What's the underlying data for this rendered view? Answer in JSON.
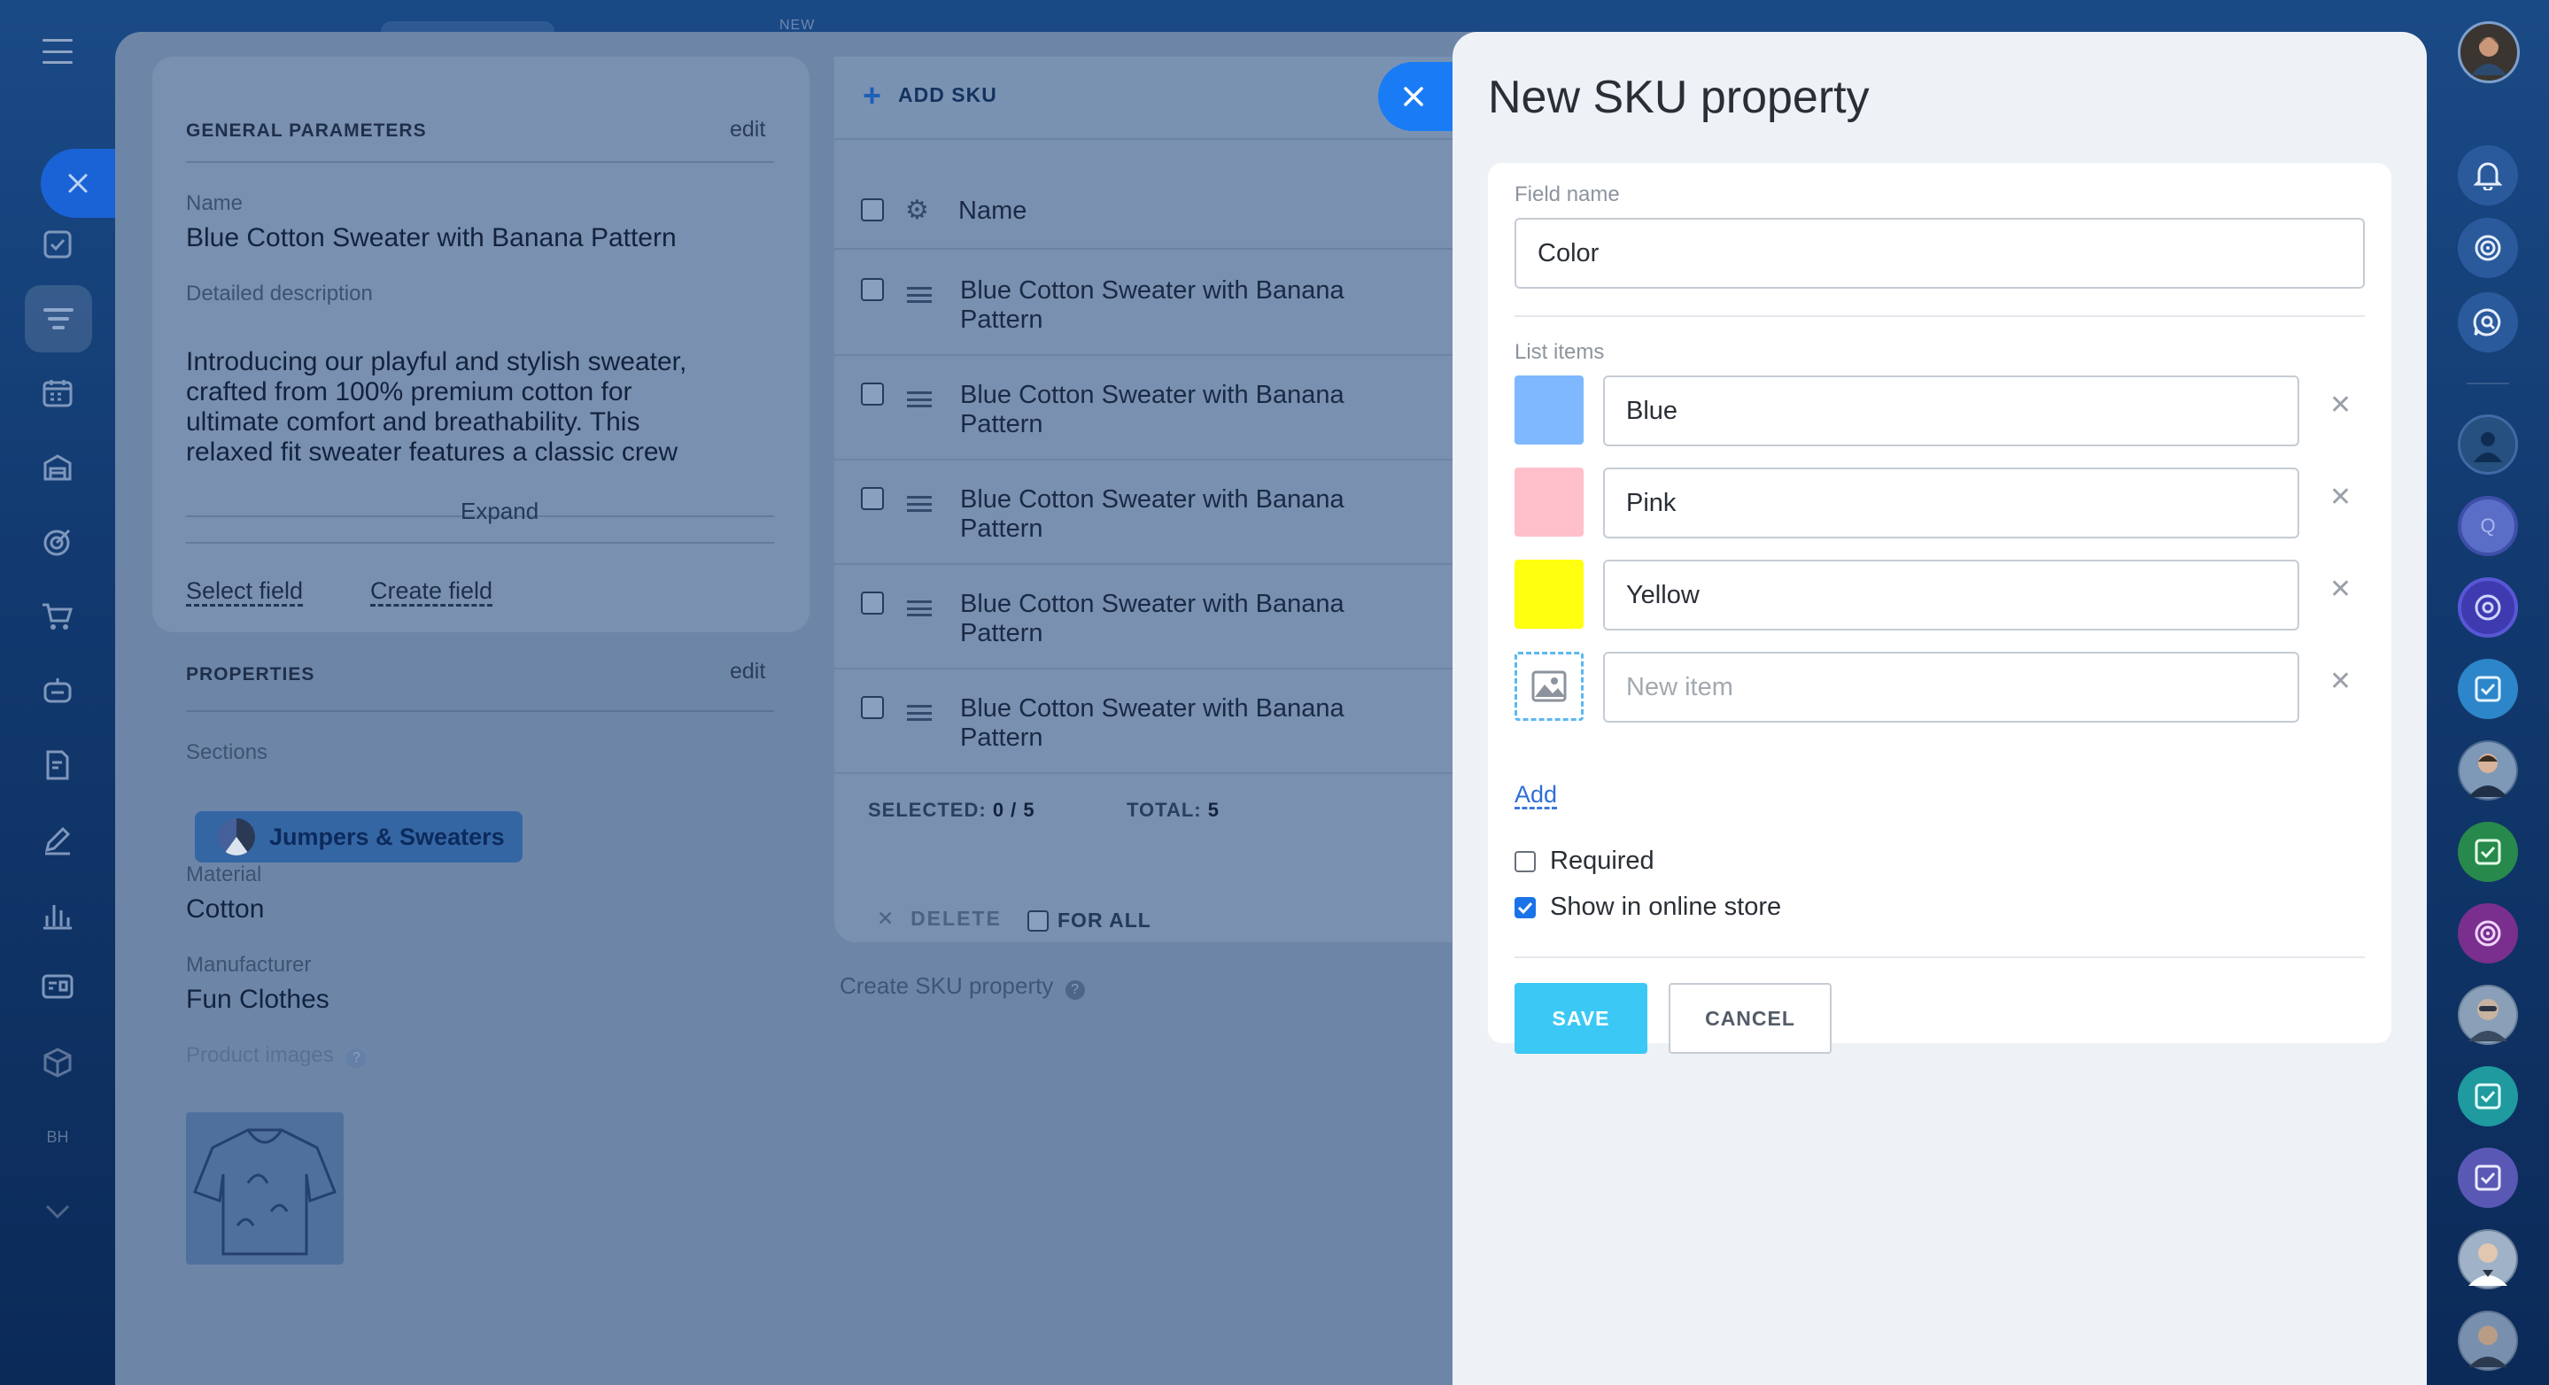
{
  "left_nav": {
    "items": [
      "tasks",
      "catalog",
      "calendar",
      "warehouse",
      "target",
      "cart",
      "robot",
      "edit-doc",
      "sign",
      "analytics",
      "card",
      "box",
      "bh",
      "more"
    ],
    "bh_label": "BH"
  },
  "top": {
    "new_badge": "NEW"
  },
  "general": {
    "title": "GENERAL PARAMETERS",
    "edit": "edit",
    "name_label": "Name",
    "name_value": "Blue Cotton Sweater with Banana Pattern",
    "desc_label": "Detailed description",
    "desc_value": "Introducing our playful and stylish sweater, crafted from 100% premium cotton for ultimate comfort and breathability. This relaxed fit sweater features a classic crew",
    "expand": "Expand",
    "select_field": "Select field",
    "create_field": "Create field"
  },
  "properties": {
    "title": "PROPERTIES",
    "edit": "edit",
    "sections_label": "Sections",
    "section_chip": "Jumpers & Sweaters",
    "material_label": "Material",
    "material_value": "Cotton",
    "manufacturer_label": "Manufacturer",
    "manufacturer_value": "Fun Clothes",
    "images_label": "Product images"
  },
  "sku": {
    "add_label": "ADD SKU",
    "col_name": "Name",
    "rows": [
      "Blue Cotton Sweater with Banana Pattern",
      "Blue Cotton Sweater with Banana Pattern",
      "Blue Cotton Sweater with Banana Pattern",
      "Blue Cotton Sweater with Banana Pattern",
      "Blue Cotton Sweater with Banana Pattern"
    ],
    "selected_label": "SELECTED:",
    "selected_value": "0 / 5",
    "total_label": "TOTAL:",
    "total_value": "5",
    "delete": "DELETE",
    "for_all": "FOR ALL",
    "create_property": "Create SKU property"
  },
  "panel": {
    "title": "New SKU property",
    "field_name_label": "Field name",
    "field_name_value": "Color",
    "list_items_label": "List items",
    "items": [
      {
        "value": "Blue",
        "color": "#7fb8ff"
      },
      {
        "value": "Pink",
        "color": "#ffc0cb"
      },
      {
        "value": "Yellow",
        "color": "#ffff10"
      }
    ],
    "new_item_placeholder": "New item",
    "add": "Add",
    "required_label": "Required",
    "required_checked": false,
    "show_online_label": "Show in online store",
    "show_online_checked": true,
    "save": "SAVE",
    "cancel": "CANCEL"
  },
  "right_bar": {
    "items": [
      "user-avatar",
      "bell-icon",
      "target-icon",
      "chat-search-icon",
      "avatar-1",
      "q-avatar",
      "group-avatar",
      "task-1",
      "avatar-2",
      "task-2",
      "fingerprint-avatar",
      "avatar-3",
      "task-3",
      "task-4",
      "avatar-4",
      "avatar-5"
    ],
    "q_letter": "Q"
  }
}
